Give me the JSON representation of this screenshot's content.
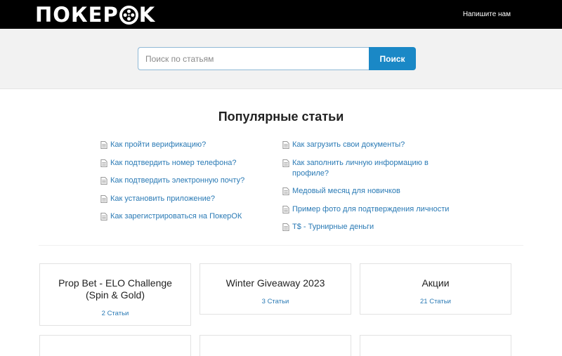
{
  "header": {
    "logo_left": "ПОКЕР",
    "logo_right": "K",
    "contact_label": "Напишите нам"
  },
  "search": {
    "placeholder": "Поиск по статьям",
    "button_label": "Поиск"
  },
  "popular": {
    "title": "Популярные статьи",
    "left_articles": [
      "Как пройти верификацию?",
      "Как подтвердить номер телефона?",
      "Как подтвердить электронную почту?",
      "Как установить приложение?",
      "Как зарегистрироваться на ПокерОК"
    ],
    "right_articles": [
      "Как загрузить свои документы?",
      "Как заполнить личную информацию в профиле?",
      "Медовый месяц для новичков",
      "Пример фото для подтверждения личности",
      "T$ - Турнирные деньги"
    ]
  },
  "categories": [
    {
      "title": "Prop Bet - ELO Challenge (Spin & Gold)",
      "count": "2 Статьи"
    },
    {
      "title": "Winter Giveaway 2023",
      "count": "3 Статьи"
    },
    {
      "title": "Акции",
      "count": "21 Статьи"
    }
  ],
  "colors": {
    "header_bg": "#000000",
    "accent": "#1a88c6",
    "link": "#2a7ab5",
    "search_band": "#f2f2f2"
  },
  "icons": {
    "article": "document-icon",
    "logo_reel": "film-reel-icon"
  }
}
